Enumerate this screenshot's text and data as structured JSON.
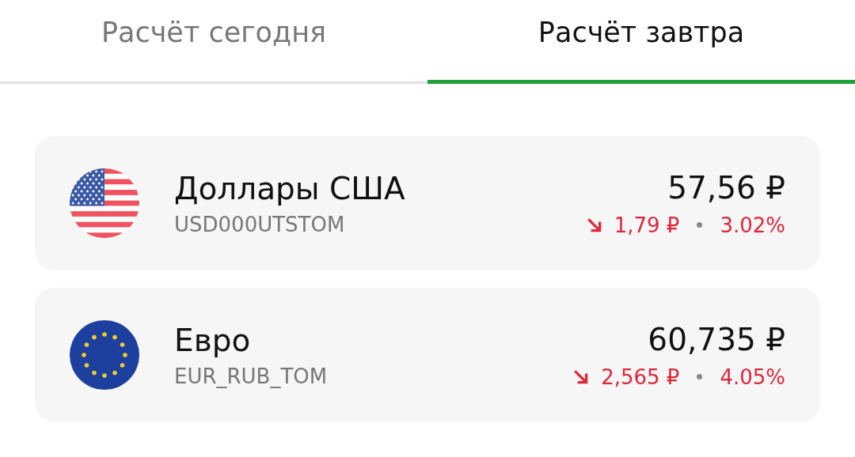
{
  "tabs": [
    {
      "label": "Расчёт сегодня",
      "selected": false
    },
    {
      "label": "Расчёт завтра",
      "selected": true
    }
  ],
  "currencies": [
    {
      "flag": {
        "kind": "us"
      },
      "name": "Доллары США",
      "code": "USD000UTSTOM",
      "price": "57,56 ₽",
      "trend": {
        "kind": "down"
      },
      "change": "1,79 ₽",
      "percent": "3.02%"
    },
    {
      "flag": {
        "kind": "eu"
      },
      "name": "Евро",
      "code": "EUR_RUB_TOM",
      "price": "60,735 ₽",
      "trend": {
        "kind": "down"
      },
      "change": "2,565 ₽",
      "percent": "4.05%"
    }
  ]
}
